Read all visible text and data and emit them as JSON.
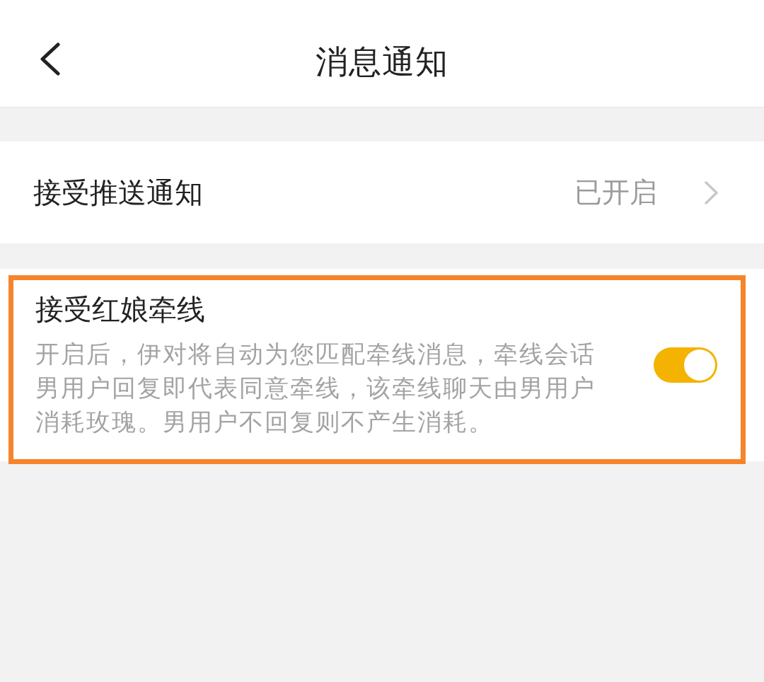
{
  "header": {
    "title": "消息通知"
  },
  "settings": [
    {
      "kind": "link",
      "label": "接受推送通知",
      "value": "已开启",
      "highlighted": false
    },
    {
      "kind": "switch",
      "label": "接受红娘牵线",
      "description": "开启后，伊对将自动为您匹配牵线消息，牵线会话男用户回复即代表同意牵线，该牵线聊天由男用户消耗玫瑰。男用户不回复则不产生消耗。",
      "on": true,
      "highlighted": true
    }
  ]
}
